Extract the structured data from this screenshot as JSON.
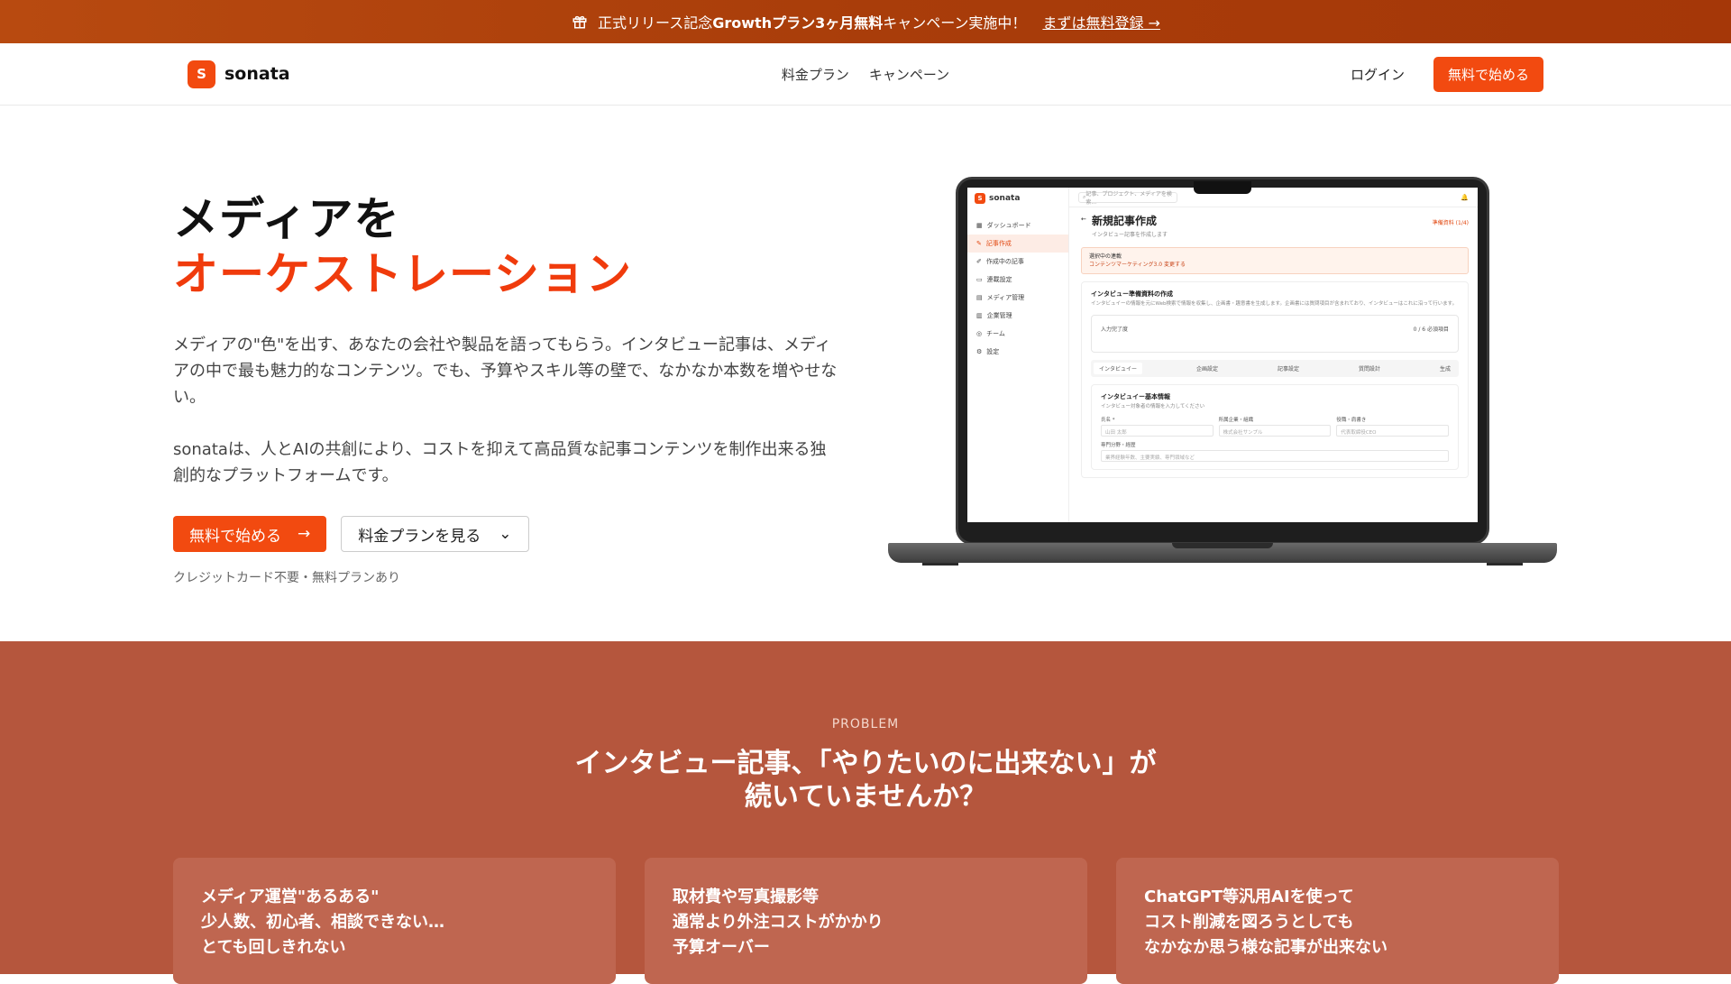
{
  "banner": {
    "text_pre": "正式リリース記念",
    "text_bold": "Growthプラン3ヶ月無料",
    "text_post": "キャンペーン実施中！",
    "link": "まずは無料登録 →"
  },
  "nav": {
    "brand_mark": "S",
    "brand": "sonata",
    "links": [
      "料金プラン",
      "キャンペーン"
    ],
    "login": "ログイン",
    "cta": "無料で始める"
  },
  "hero": {
    "title_line1": "メディアを",
    "title_line2": "オーケストレーション",
    "lead1": "メディアの\"色\"を出す、あなたの会社や製品を語ってもらう。インタビュー記事は、メディアの中で最も魅力的なコンテンツ。でも、予算やスキル等の壁で、なかなか本数を増やせない。",
    "lead2": "sonataは、人とAIの共創により、コストを抑えて高品質な記事コンテンツを制作出来る独創的なプラットフォームです。",
    "primary_button": "無料で始める",
    "secondary_button": "料金プランを見る",
    "note": "クレジットカード不要・無料プランあり"
  },
  "mockup": {
    "brand": "sonata",
    "search_placeholder": "記事、プロジェクト、メディアを検索...",
    "sidebar": [
      "ダッシュボード",
      "記事作成",
      "作成中の記事",
      "連載設定",
      "メディア管理",
      "企業管理",
      "チーム",
      "設定"
    ],
    "page_title": "新規記事作成",
    "page_sub": "インタビュー記事を作成します",
    "badge": "準備資料 (1/4)",
    "alert_title": "選択中の連載",
    "alert_body": "コンテンツマーケティング3.0 変更する",
    "card_title": "インタビュー準備資料の作成",
    "card_desc": "インタビュイーの情報を元にWeb検索で情報を収集し、企画書・趣意書を生成します。企画書には質問項目が含まれており、インタビューはこれに沿って行います。",
    "progress_label": "入力完了度",
    "progress_value": "0 / 6 必須項目",
    "tabs": [
      "インタビュイー",
      "企画設定",
      "記事設定",
      "質問設計",
      "生成"
    ],
    "form_title": "インタビュイー基本情報",
    "form_sub": "インタビュー対象者の情報を入力してください",
    "fields": [
      {
        "label": "氏名 *",
        "placeholder": "山田 太郎"
      },
      {
        "label": "所属企業・組織",
        "placeholder": "株式会社サンプル"
      },
      {
        "label": "役職・肩書き",
        "placeholder": "代表取締役CEO"
      }
    ],
    "field_wide_label": "専門分野・経歴",
    "field_wide_placeholder": "業界経験年数、主要実績、専門領域など"
  },
  "problem": {
    "kicker": "PROBLEM",
    "title_line1": "インタビュー記事、「やりたいのに出来ない」が",
    "title_line2": "続いていませんか？",
    "cards": [
      {
        "l1": "メディア運営\"あるある\"",
        "l2": "少人数、初心者、相談できない…",
        "l3": "とても回しきれない"
      },
      {
        "l1": "取材費や写真撮影等",
        "l2": "通常より外注コストがかかり",
        "l3": "予算オーバー"
      },
      {
        "l1": "ChatGPT等汎用AIを使って",
        "l2": "コスト削減を図ろうとしても",
        "l3": "なかなか思う様な記事が出来ない"
      }
    ]
  },
  "colors": {
    "accent": "#f24a10",
    "banner": "#a93d0a",
    "problem_bg": "#b5563d"
  }
}
